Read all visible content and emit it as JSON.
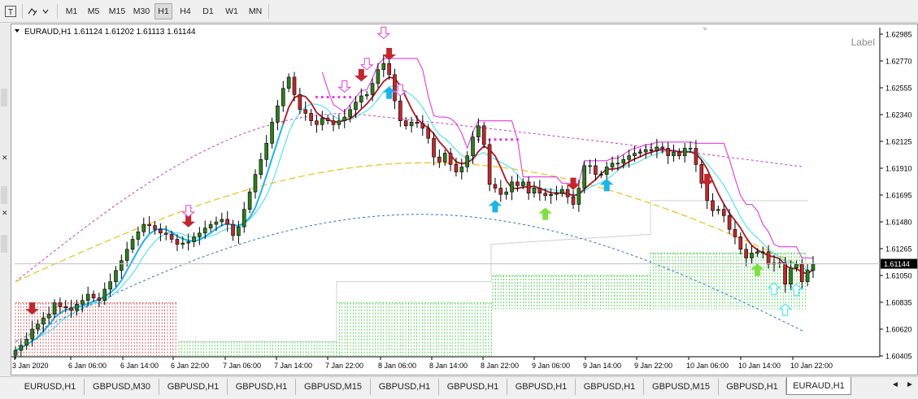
{
  "toolbar": {
    "timeframes": [
      {
        "label": "M1",
        "active": false
      },
      {
        "label": "M5",
        "active": false
      },
      {
        "label": "M15",
        "active": false
      },
      {
        "label": "M30",
        "active": false
      },
      {
        "label": "H1",
        "active": true
      },
      {
        "label": "H4",
        "active": false
      },
      {
        "label": "D1",
        "active": false
      },
      {
        "label": "W1",
        "active": false
      },
      {
        "label": "MN",
        "active": false
      }
    ],
    "icons": [
      "text-tool-icon",
      "shapes-tool-icon"
    ]
  },
  "chart": {
    "header": "EURAUD,H1  1.61124 1.61202 1.61113 1.61144",
    "label_object": "Label",
    "current_price": "1.61144",
    "colors": {
      "bull": "#2e7d1e",
      "bear": "#c0282d",
      "red_ma": "#d01010",
      "magenta_line": "#e03ce0",
      "cyan_thick": "#1eb4e8",
      "cyan_thin": "#38e0f0",
      "orange_dash": "#f0b800",
      "blue_dash": "#2f70c8",
      "purple_dash": "#cc33cc",
      "green_grid": "#33cc33",
      "red_grid": "#cc3333",
      "price_line": "#c0c0c0"
    }
  },
  "chart_data": {
    "type": "candlestick",
    "symbol": "EURAUD",
    "timeframe": "H1",
    "ylim": [
      1.60405,
      1.62985
    ],
    "y_ticks": [
      "1.62985",
      "1.62770",
      "1.62555",
      "1.62340",
      "1.62125",
      "1.61910",
      "1.61695",
      "1.61480",
      "1.61265",
      "1.61050",
      "1.60835",
      "1.60620",
      "1.60405"
    ],
    "x_ticks": [
      "3 Jan 2020",
      "6 Jan 06:00",
      "6 Jan 14:00",
      "6 Jan 22:00",
      "7 Jan 06:00",
      "7 Jan 14:00",
      "7 Jan 22:00",
      "8 Jan 06:00",
      "8 Jan 14:00",
      "8 Jan 22:00",
      "9 Jan 06:00",
      "9 Jan 14:00",
      "9 Jan 22:00",
      "10 Jan 06:00",
      "10 Jan 14:00",
      "10 Jan 22:00"
    ],
    "close_approx": [
      1.6045,
      1.6049,
      1.6054,
      1.6062,
      1.6066,
      1.6071,
      1.6074,
      1.6083,
      1.608,
      1.6079,
      1.6077,
      1.6082,
      1.6085,
      1.609,
      1.6087,
      1.6085,
      1.6094,
      1.61,
      1.6109,
      1.6117,
      1.6126,
      1.6134,
      1.614,
      1.6146,
      1.6145,
      1.6142,
      1.6139,
      1.6138,
      1.6134,
      1.613,
      1.6131,
      1.6132,
      1.6136,
      1.6139,
      1.6143,
      1.6146,
      1.6148,
      1.615,
      1.6146,
      1.6137,
      1.6144,
      1.6158,
      1.6172,
      1.6186,
      1.6198,
      1.6211,
      1.6228,
      1.6241,
      1.6255,
      1.6264,
      1.625,
      1.6238,
      1.6235,
      1.6229,
      1.6226,
      1.6231,
      1.6229,
      1.6226,
      1.6229,
      1.6232,
      1.6238,
      1.6244,
      1.6249,
      1.625,
      1.6259,
      1.627,
      1.6275,
      1.6266,
      1.6245,
      1.6229,
      1.6225,
      1.6228,
      1.6227,
      1.6223,
      1.6215,
      1.62,
      1.6196,
      1.6203,
      1.6194,
      1.6188,
      1.6192,
      1.6201,
      1.6216,
      1.6225,
      1.621,
      1.6178,
      1.6175,
      1.617,
      1.6172,
      1.618,
      1.6177,
      1.618,
      1.6171,
      1.6175,
      1.6171,
      1.6169,
      1.617,
      1.6171,
      1.6174,
      1.6168,
      1.6162,
      1.6175,
      1.6193,
      1.6193,
      1.6186,
      1.6186,
      1.6192,
      1.6195,
      1.6195,
      1.6198,
      1.6201,
      1.6203,
      1.6204,
      1.6206,
      1.6205,
      1.6208,
      1.6207,
      1.6201,
      1.6204,
      1.6201,
      1.6207,
      1.6207,
      1.6194,
      1.6179,
      1.6165,
      1.6157,
      1.6158,
      1.6153,
      1.6142,
      1.6136,
      1.6126,
      1.6119,
      1.6123,
      1.6124,
      1.6124,
      1.6114,
      1.6115,
      1.6115,
      1.6098,
      1.6111,
      1.6114,
      1.61,
      1.6109,
      1.6114
    ],
    "signals": {
      "down_arrow_red": [
        3,
        31,
        62,
        67,
        100,
        124
      ],
      "down_arrow_outline_magenta": [
        31,
        59,
        63,
        66,
        69
      ],
      "up_arrow_blue": [
        67,
        86,
        106
      ],
      "up_arrow_green": [
        95,
        133
      ],
      "up_arrow_outline_cyan": [
        136,
        138,
        140
      ]
    }
  },
  "tabs": {
    "items": [
      {
        "label": "EURUSD,H1",
        "active": false
      },
      {
        "label": "GBPUSD,M30",
        "active": false
      },
      {
        "label": "GBPUSD,H1",
        "active": false
      },
      {
        "label": "GBPUSD,H1",
        "active": false
      },
      {
        "label": "GBPUSD,M15",
        "active": false
      },
      {
        "label": "GBPUSD,H1",
        "active": false
      },
      {
        "label": "GBPUSD,H1",
        "active": false
      },
      {
        "label": "GBPUSD,H1",
        "active": false
      },
      {
        "label": "GBPUSD,H1",
        "active": false
      },
      {
        "label": "GBPUSD,M15",
        "active": false
      },
      {
        "label": "GBPUSD,H1",
        "active": false
      },
      {
        "label": "EURAUD,H1",
        "active": true
      }
    ],
    "nav_left": "◄",
    "nav_right": "►"
  }
}
